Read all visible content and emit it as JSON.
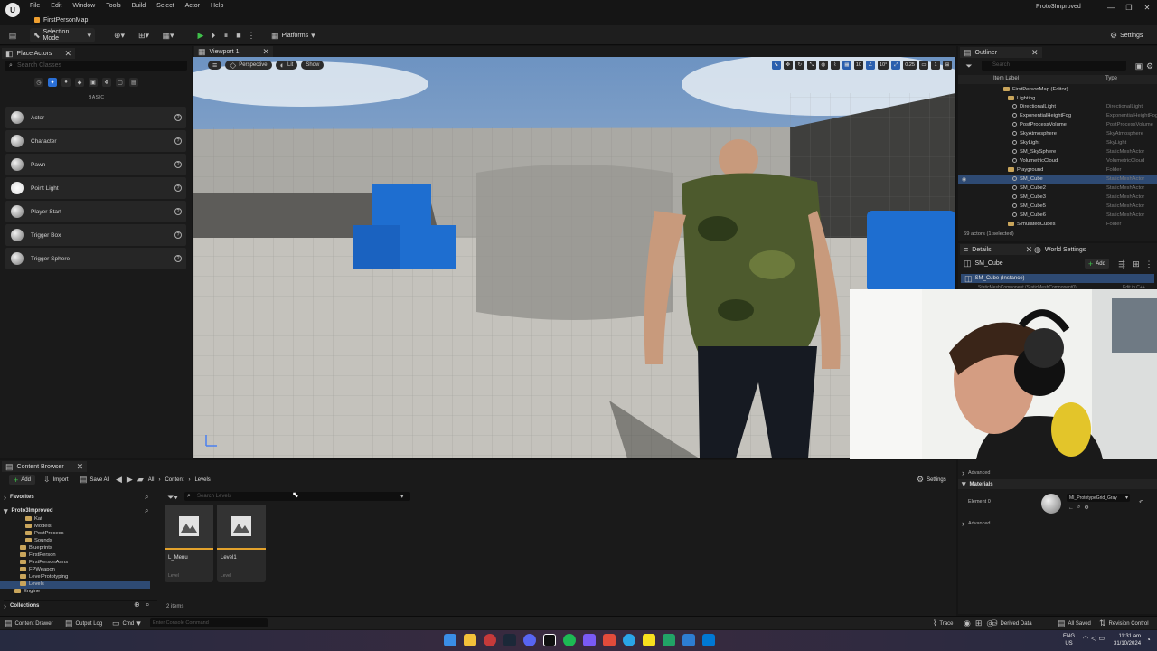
{
  "menubar": {
    "logo": "U",
    "items": [
      "File",
      "Edit",
      "Window",
      "Tools",
      "Build",
      "Select",
      "Actor",
      "Help"
    ],
    "map_tab": "FirstPersonMap",
    "project": "Proto3Improved"
  },
  "toolbar": {
    "selection_mode": "Selection Mode",
    "platforms": "Platforms",
    "settings": "Settings"
  },
  "place_actors": {
    "tab": "Place Actors",
    "search_placeholder": "Search Classes",
    "category": "BASIC",
    "items": [
      "Actor",
      "Character",
      "Pawn",
      "Point Light",
      "Player Start",
      "Trigger Box",
      "Trigger Sphere"
    ]
  },
  "viewport": {
    "tab": "Viewport 1",
    "perspective": "Perspective",
    "lit": "Lit",
    "show": "Show",
    "grid": "10",
    "angle": "10°",
    "scale": "0.25",
    "cam": "1"
  },
  "outliner": {
    "tab": "Outliner",
    "search_placeholder": "Search",
    "col_label": "Item Label",
    "col_type": "Type",
    "rows": [
      {
        "label": "FirstPersonMap (Editor)",
        "type": ""
      },
      {
        "label": "Lighting",
        "type": ""
      },
      {
        "label": "DirectionalLight",
        "type": "DirectionalLight"
      },
      {
        "label": "ExponentialHeightFog",
        "type": "ExponentialHeightFog"
      },
      {
        "label": "PostProcessVolume",
        "type": "PostProcessVolume"
      },
      {
        "label": "SkyAtmosphere",
        "type": "SkyAtmosphere"
      },
      {
        "label": "SkyLight",
        "type": "SkyLight"
      },
      {
        "label": "SM_SkySphere",
        "type": "StaticMeshActor"
      },
      {
        "label": "VolumetricCloud",
        "type": "VolumetricCloud"
      },
      {
        "label": "Playground",
        "type": "Folder"
      },
      {
        "label": "SM_Cube",
        "type": "StaticMeshActor"
      },
      {
        "label": "SM_Cube2",
        "type": "StaticMeshActor"
      },
      {
        "label": "SM_Cube3",
        "type": "StaticMeshActor"
      },
      {
        "label": "SM_Cube5",
        "type": "StaticMeshActor"
      },
      {
        "label": "SM_Cube6",
        "type": "StaticMeshActor"
      },
      {
        "label": "SimulatedCubes",
        "type": "Folder"
      }
    ],
    "footer": "69 actors (1 selected)"
  },
  "details": {
    "tab": "Details",
    "tab2": "World Settings",
    "object": "SM_Cube",
    "add": "Add",
    "instance": "SM_Cube (Instance)",
    "component": "StaticMeshComponent (StaticMeshComponent0)",
    "edit_cpp": "Edit in C++",
    "advanced1": "Advanced",
    "materials": "Materials",
    "element": "Element 0",
    "material": "MI_PrototypeGrid_Gray",
    "advanced2": "Advanced"
  },
  "content_browser": {
    "tab": "Content Browser",
    "add": "Add",
    "import": "Import",
    "save_all": "Save All",
    "crumbs": [
      "All",
      "Content",
      "Levels"
    ],
    "settings": "Settings",
    "favorites": "Favorites",
    "project": "Proto3Improved",
    "search_placeholder": "Search Levels",
    "tree": [
      "Kat",
      "Models",
      "PostProcess",
      "Sounds",
      "Blueprints",
      "FirstPerson",
      "FirstPersonArms",
      "FPWeapon",
      "LevelPrototyping",
      "Levels",
      "Engine"
    ],
    "collections": "Collections",
    "assets": [
      {
        "name": "L_Menu",
        "type": "Level"
      },
      {
        "name": "Level1",
        "type": "Level"
      }
    ],
    "count": "2 items"
  },
  "statusbar": {
    "content_drawer": "Content Drawer",
    "output_log": "Output Log",
    "cmd": "Cmd",
    "console_placeholder": "Enter Console Command",
    "trace": "Trace",
    "derived_data": "Derived Data",
    "all_saved": "All Saved",
    "revision_control": "Revision Control"
  },
  "taskbar": {
    "lang": "ENG",
    "region": "US",
    "time": "11:31 am",
    "date": "31/10/2024"
  }
}
